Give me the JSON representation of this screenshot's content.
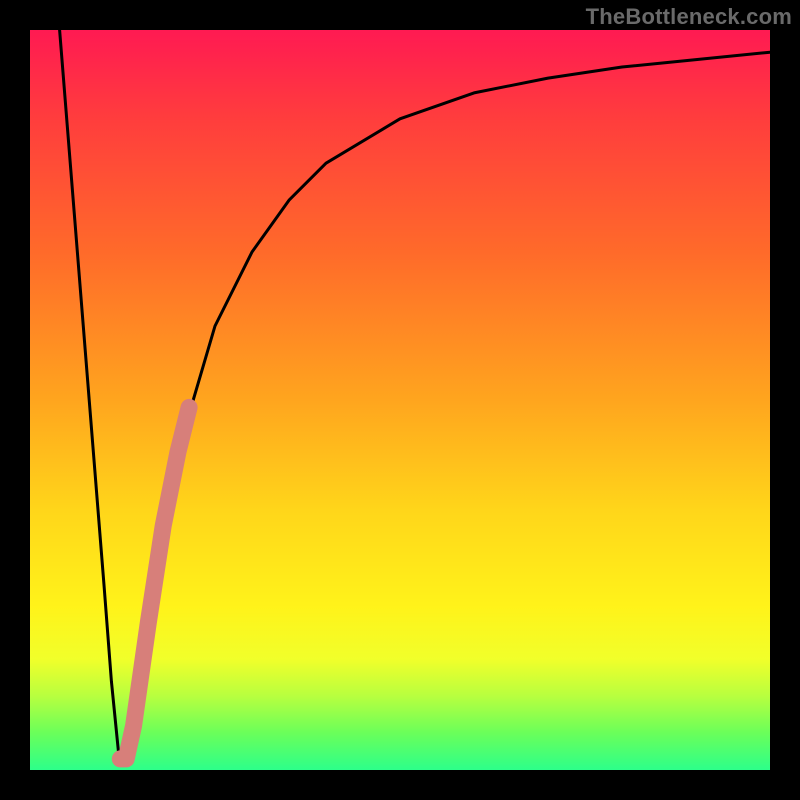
{
  "watermark": {
    "text": "TheBottleneck.com"
  },
  "colors": {
    "curve_stroke": "#000000",
    "highlight_stroke": "#d77f7a",
    "frame_bg": "#000000"
  },
  "chart_data": {
    "type": "line",
    "title": "",
    "xlabel": "",
    "ylabel": "",
    "xlim": [
      0,
      100
    ],
    "ylim": [
      0,
      100
    ],
    "series": [
      {
        "name": "bottleneck-curve",
        "x": [
          4,
          6,
          8,
          10,
          11,
          12,
          13,
          14,
          16,
          18,
          20,
          25,
          30,
          35,
          40,
          50,
          60,
          70,
          80,
          90,
          100
        ],
        "y": [
          100,
          75,
          50,
          25,
          12,
          2,
          1,
          6,
          20,
          33,
          43,
          60,
          70,
          77,
          82,
          88,
          91.5,
          93.5,
          95,
          96,
          97
        ]
      }
    ],
    "highlight_segment": {
      "name": "highlight",
      "x": [
        12.2,
        13.0,
        14.0,
        16.0,
        18.0,
        20.0,
        21.5
      ],
      "y": [
        1.5,
        1.5,
        6,
        20,
        33,
        43,
        49
      ]
    }
  }
}
